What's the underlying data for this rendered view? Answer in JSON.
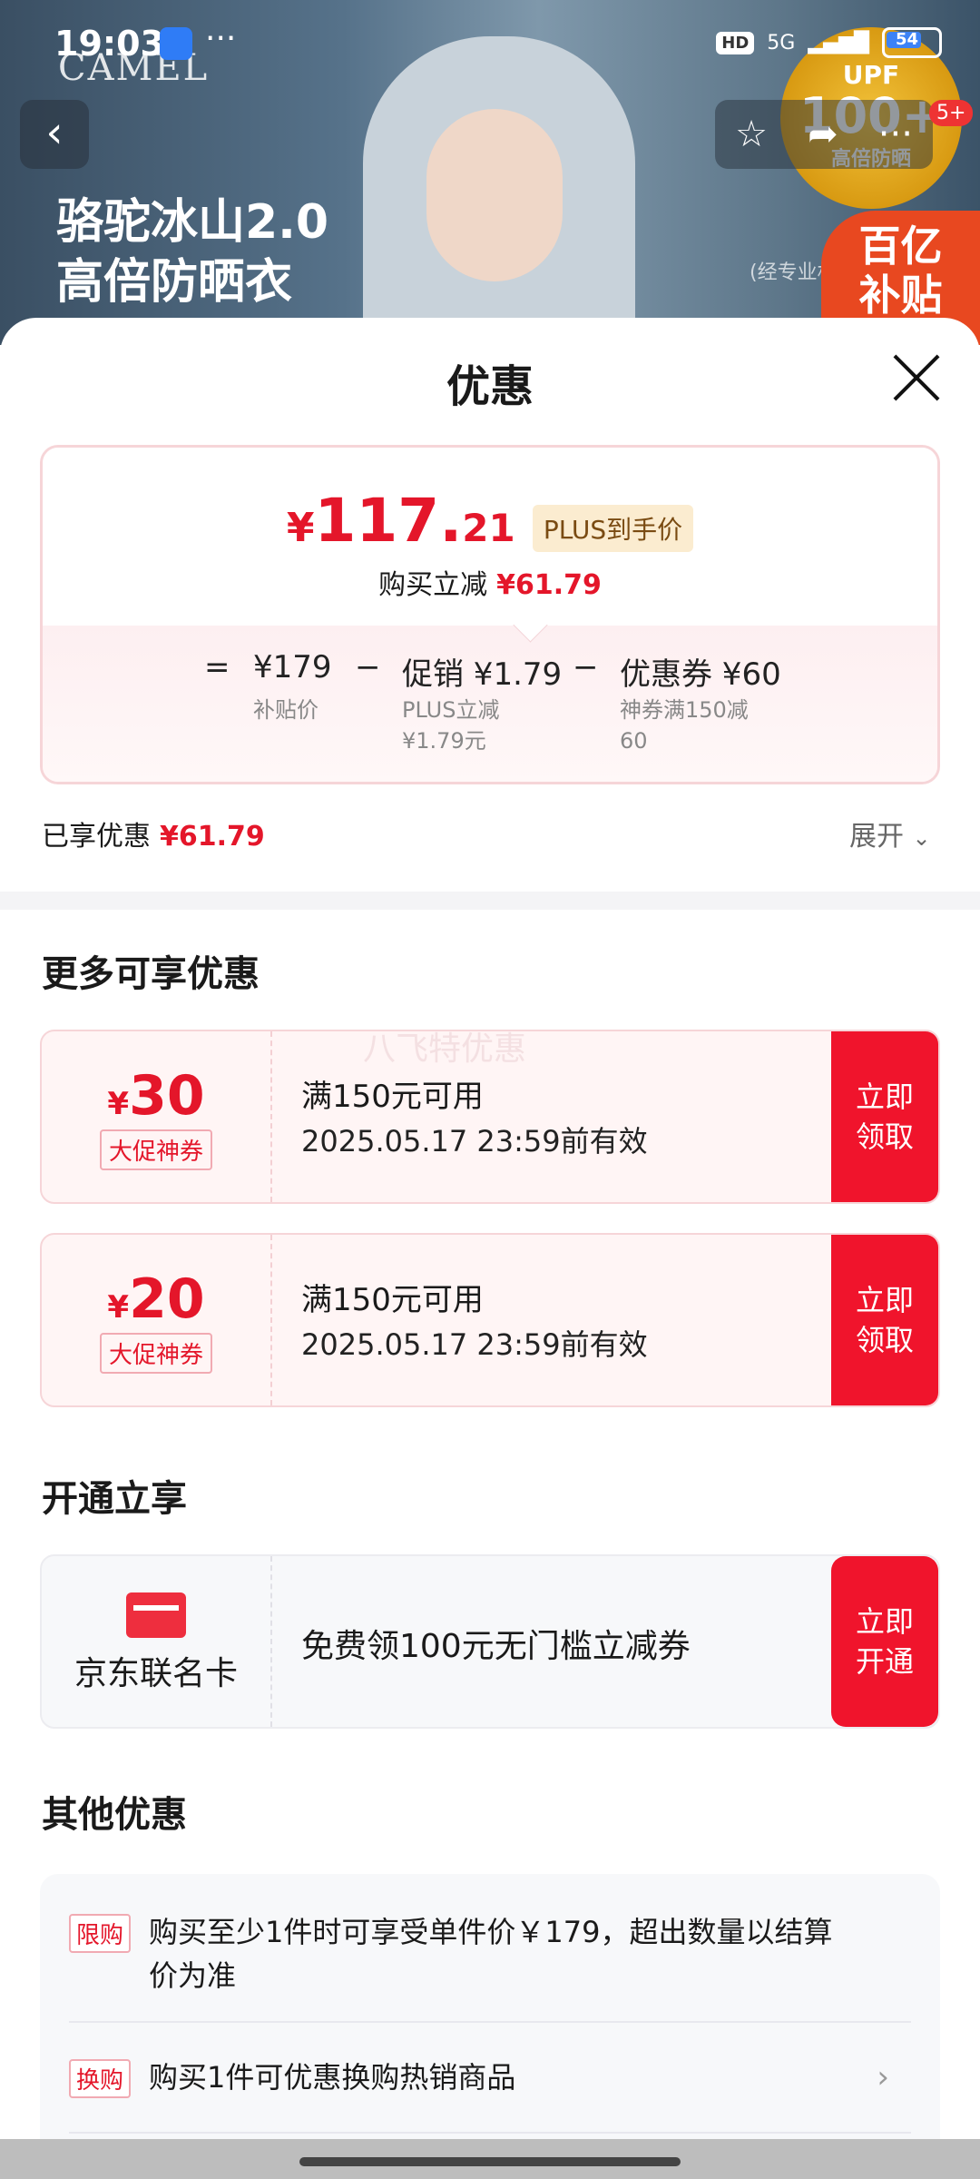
{
  "status_bar": {
    "time": "19:03",
    "dots": "···",
    "hd": "HD",
    "network": "5G",
    "battery": "54"
  },
  "banner": {
    "brand": "CAMEL",
    "headline_line1": "骆驼冰山2.0",
    "headline_line2": "高倍防晒衣",
    "upf_top": "UPF",
    "upf_value": "100+",
    "upf_sub": "高倍防晒",
    "billion_line1": "百亿",
    "billion_line2": "补贴",
    "small_text": "(经专业机",
    "badge": "5+"
  },
  "sheet": {
    "title": "优惠",
    "final_price": {
      "currency": "¥",
      "integer": "117.",
      "decimal": "21"
    },
    "plus_tag": "PLUS到手价",
    "instant_label": "购买立减",
    "instant_amount": "¥61.79",
    "calc": {
      "equals": "=",
      "base": "¥179",
      "base_sub": "补贴价",
      "minus1": "−",
      "promo": "促销 ¥1.79",
      "promo_sub1": "PLUS立减",
      "promo_sub2": "¥1.79元",
      "minus2": "−",
      "coupon": "优惠券 ¥60",
      "coupon_sub1": "神券满150减",
      "coupon_sub2": "60"
    },
    "enjoyed_label": "已享优惠",
    "enjoyed_amount": "¥61.79",
    "expand_label": "展开"
  },
  "more_section": {
    "title": "更多可享优惠",
    "watermark": "八飞特优惠",
    "coupons": [
      {
        "currency": "¥",
        "value": "30",
        "tag": "大促神券",
        "condition": "满150元可用",
        "validity": "2025.05.17 23:59前有效",
        "btn_line1": "立即",
        "btn_line2": "领取"
      },
      {
        "currency": "¥",
        "value": "20",
        "tag": "大促神券",
        "condition": "满150元可用",
        "validity": "2025.05.17 23:59前有效",
        "btn_line1": "立即",
        "btn_line2": "领取"
      }
    ]
  },
  "open_section": {
    "title": "开通立享",
    "card_name": "京东联名卡",
    "description": "免费领100元无门槛立减券",
    "btn_line1": "立即",
    "btn_line2": "开通"
  },
  "other_section": {
    "title": "其他优惠",
    "items": [
      {
        "tag": "限购",
        "text": "购买至少1件时可享受单件价￥179，超出数量以结算价为准"
      },
      {
        "tag": "换购",
        "text": "购买1件可优惠换购热销商品"
      }
    ]
  },
  "colors": {
    "accent": "#e4162a",
    "button": "#f0142c",
    "plus_tag_bg": "#fbecd0"
  }
}
